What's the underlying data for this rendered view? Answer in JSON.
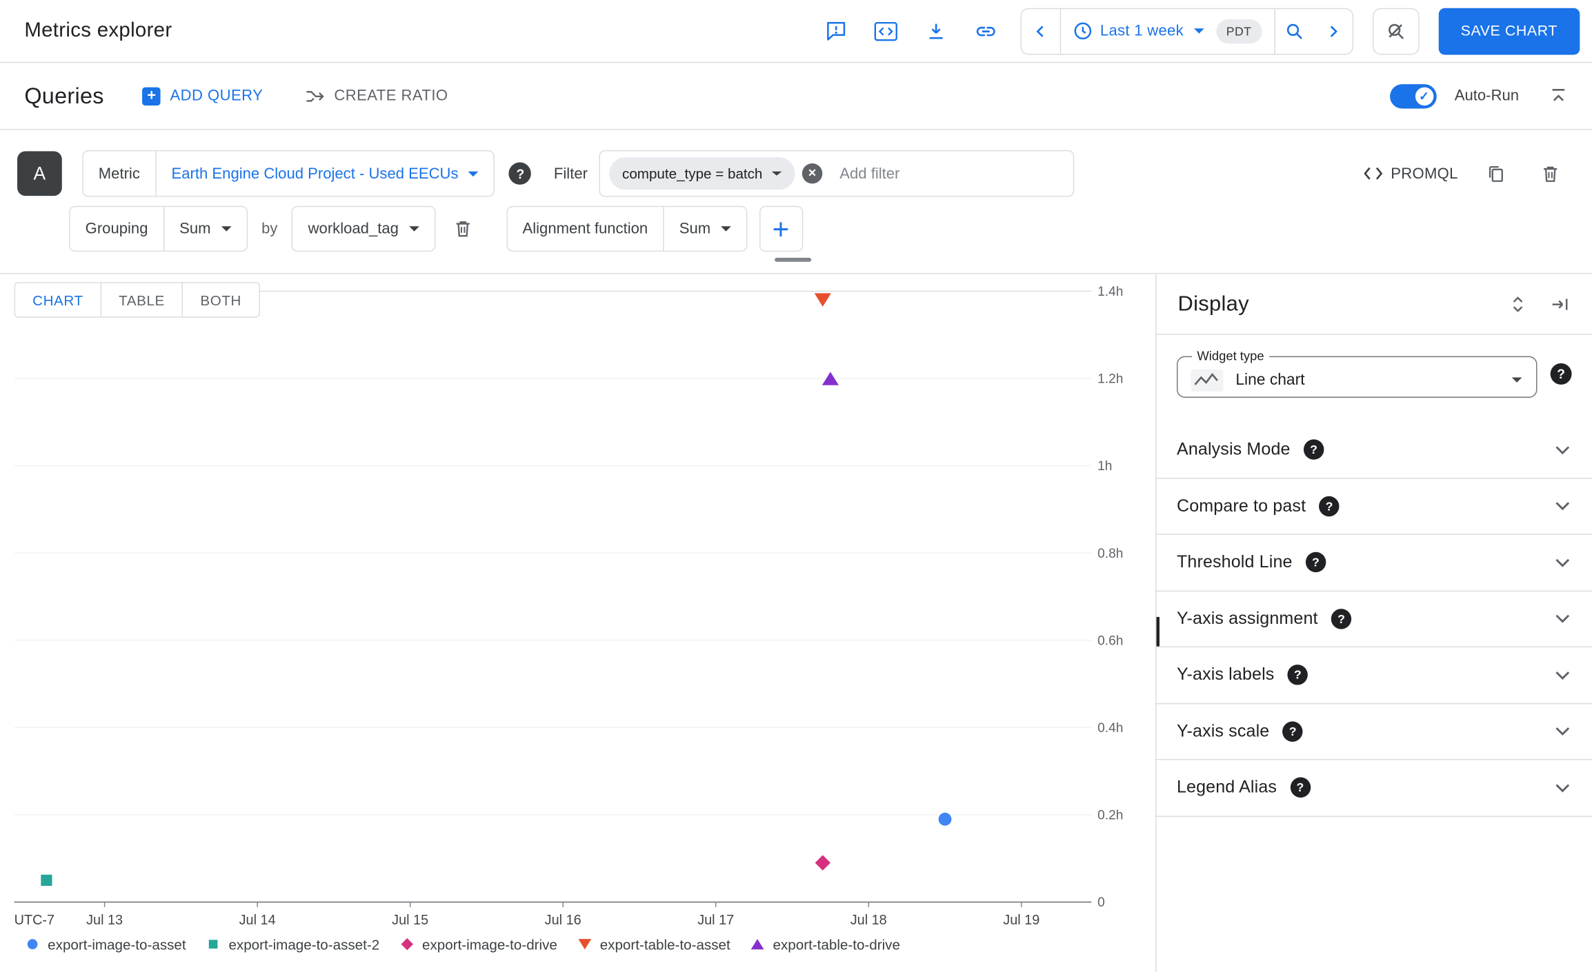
{
  "header": {
    "title": "Metrics explorer",
    "toolbar_icons": [
      "feedback-icon",
      "code-icon",
      "download-icon",
      "link-icon",
      "search-off-icon"
    ],
    "time_range": {
      "value": "Last 1 week",
      "timezone": "PDT"
    },
    "save_button": "SAVE CHART"
  },
  "queries": {
    "title": "Queries",
    "add_query_label": "ADD QUERY",
    "create_ratio_label": "CREATE RATIO",
    "auto_run_label": "Auto-Run",
    "auto_run_enabled": true
  },
  "query": {
    "id": "A",
    "metric": {
      "label": "Metric",
      "value": "Earth Engine Cloud Project - Used EECUs"
    },
    "filter": {
      "label": "Filter",
      "chip": "compute_type = batch",
      "placeholder": "Add filter"
    },
    "promql_label": "PROMQL",
    "grouping": {
      "label": "Grouping",
      "value": "Sum",
      "by_label": "by",
      "by_value": "workload_tag"
    },
    "alignment": {
      "label": "Alignment function",
      "value": "Sum"
    }
  },
  "view_tabs": {
    "labels": [
      "CHART",
      "TABLE",
      "BOTH"
    ],
    "active": "CHART"
  },
  "chart_data": {
    "type": "scatter",
    "title": "",
    "x_axis": {
      "timezone_label": "UTC-7",
      "tick_labels": [
        "Jul 13",
        "Jul 14",
        "Jul 15",
        "Jul 16",
        "Jul 17",
        "Jul 18",
        "Jul 19"
      ],
      "range_days": [
        12.41,
        19.46
      ]
    },
    "y_axis": {
      "tick_labels": [
        "1.4h",
        "1.2h",
        "1h",
        "0.8h",
        "0.6h",
        "0.4h",
        "0.2h",
        "0"
      ],
      "unit": "hours",
      "min": 0,
      "max": 1.4
    },
    "grid": true,
    "legend_position": "bottom",
    "series": [
      {
        "name": "export-image-to-asset",
        "marker": "circle",
        "color": "#4285f4",
        "points": [
          {
            "day": 18.5,
            "hours": 0.19
          }
        ]
      },
      {
        "name": "export-image-to-asset-2",
        "marker": "square",
        "color": "#26a69a",
        "points": [
          {
            "day": 12.62,
            "hours": 0.05
          }
        ]
      },
      {
        "name": "export-image-to-drive",
        "marker": "diamond",
        "color": "#d5317f",
        "points": [
          {
            "day": 17.7,
            "hours": 0.09
          }
        ]
      },
      {
        "name": "export-table-to-asset",
        "marker": "triangle-down",
        "color": "#e8502d",
        "points": [
          {
            "day": 17.7,
            "hours": 1.38
          }
        ]
      },
      {
        "name": "export-table-to-drive",
        "marker": "triangle-up",
        "color": "#8430ce",
        "points": [
          {
            "day": 17.75,
            "hours": 1.2
          }
        ]
      }
    ]
  },
  "display_panel": {
    "title": "Display",
    "widget_type": {
      "label": "Widget type",
      "value": "Line chart"
    },
    "sections": [
      {
        "label": "Analysis Mode"
      },
      {
        "label": "Compare to past"
      },
      {
        "label": "Threshold Line"
      },
      {
        "label": "Y-axis assignment"
      },
      {
        "label": "Y-axis labels"
      },
      {
        "label": "Y-axis scale"
      },
      {
        "label": "Legend Alias"
      }
    ]
  },
  "colors": {
    "accent": "#1a73e8",
    "border": "#dadce0",
    "text": "#202124",
    "muted_text": "#5f6368"
  }
}
